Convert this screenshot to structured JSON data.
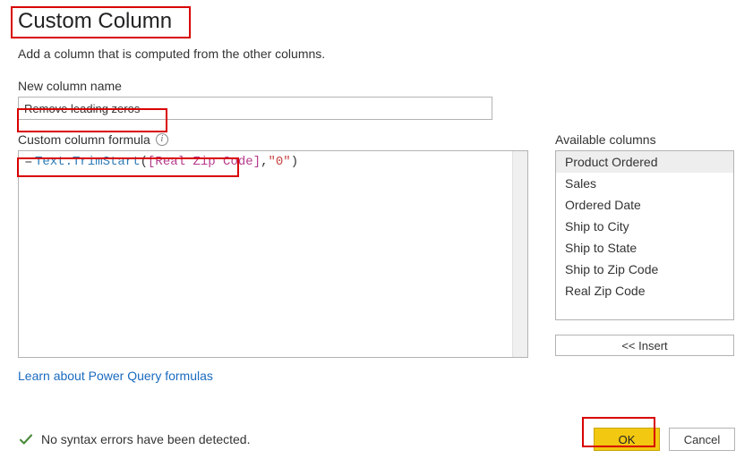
{
  "dialog": {
    "title": "Custom Column",
    "subtitle": "Add a column that is computed from the other columns."
  },
  "name": {
    "label": "New column name",
    "value": "Remove leading zeros"
  },
  "formula": {
    "label": "Custom column formula",
    "prefix": "= ",
    "fn": "Text.TrimStart",
    "open": "(",
    "col": "[Real Zip Code]",
    "comma": ",",
    "str": "\"0\"",
    "close": ")",
    "full": "= Text.TrimStart([Real Zip Code],\"0\")"
  },
  "available": {
    "label": "Available columns",
    "items": [
      "Product Ordered",
      "Sales",
      "Ordered Date",
      "Ship to City",
      "Ship to State",
      "Ship to Zip Code",
      "Real Zip Code"
    ],
    "selected_index": 0,
    "insert_label": "<< Insert"
  },
  "link": {
    "text": "Learn about Power Query formulas"
  },
  "status": {
    "text": "No syntax errors have been detected."
  },
  "buttons": {
    "ok": "OK",
    "cancel": "Cancel"
  }
}
